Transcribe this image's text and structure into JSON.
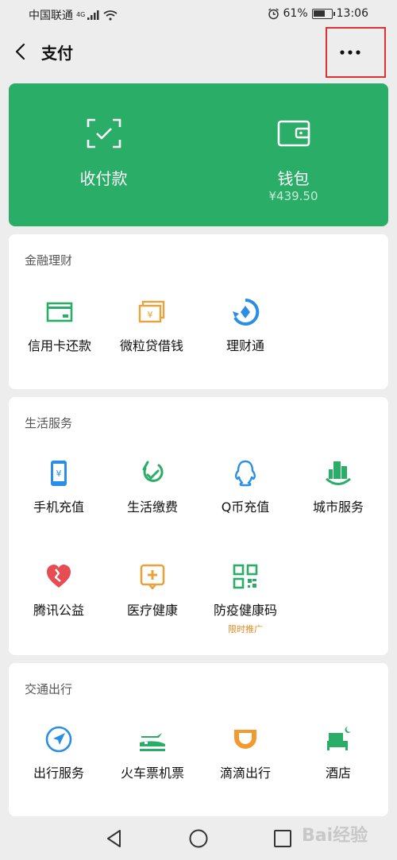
{
  "status_bar": {
    "carrier": "中国联通",
    "network": "4G",
    "battery_pct": "61%",
    "time": "13:06"
  },
  "nav": {
    "title": "支付",
    "back_icon": "chevron-left-icon",
    "more_icon": "more-dots-icon"
  },
  "wallet": {
    "receive_pay_label": "收付款",
    "wallet_label": "钱包",
    "balance": "¥439.50",
    "color": "#2aad67"
  },
  "finance": {
    "title": "金融理财",
    "items": [
      {
        "label": "信用卡还款",
        "icon": "credit-card-icon"
      },
      {
        "label": "微粒贷借钱",
        "icon": "loan-money-icon"
      },
      {
        "label": "理财通",
        "icon": "licaitong-icon"
      }
    ]
  },
  "life": {
    "title": "生活服务",
    "items": [
      {
        "label": "手机充值",
        "icon": "phone-recharge-icon"
      },
      {
        "label": "生活缴费",
        "icon": "utility-bill-icon"
      },
      {
        "label": "Q币充值",
        "icon": "qq-penguin-icon"
      },
      {
        "label": "城市服务",
        "icon": "city-building-icon"
      },
      {
        "label": "腾讯公益",
        "icon": "charity-heart-icon"
      },
      {
        "label": "医疗健康",
        "icon": "medical-cross-icon"
      },
      {
        "label": "防疫健康码",
        "icon": "qr-code-icon",
        "tag": "限时推广"
      }
    ]
  },
  "transport": {
    "title": "交通出行",
    "items": [
      {
        "label": "出行服务",
        "icon": "navigation-arrow-icon"
      },
      {
        "label": "火车票机票",
        "icon": "train-plane-icon"
      },
      {
        "label": "滴滴出行",
        "icon": "didi-icon"
      },
      {
        "label": "酒店",
        "icon": "hotel-bed-icon"
      }
    ]
  },
  "watermark": "Bai经验"
}
